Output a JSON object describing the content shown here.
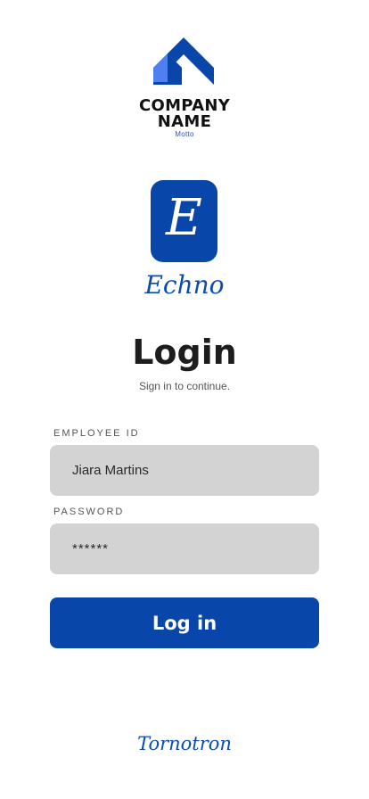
{
  "company": {
    "name_line1": "COMPANY",
    "name_line2": "NAME",
    "motto": "Motto",
    "logo_icon": "company-logo-icon"
  },
  "app": {
    "icon_glyph": "E",
    "name": "Echno"
  },
  "login": {
    "title": "Login",
    "subtitle": "Sign in to continue."
  },
  "form": {
    "employee_id_label": "EMPLOYEE ID",
    "employee_id_value": "Jiara Martins",
    "password_label": "PASSWORD",
    "password_value": "******",
    "submit_label": "Log in"
  },
  "footer": {
    "brand": "Tornotron"
  },
  "colors": {
    "brand_blue": "#0847a9",
    "light_blue": "#4f7ff0",
    "input_bg": "#d3d3d3"
  }
}
